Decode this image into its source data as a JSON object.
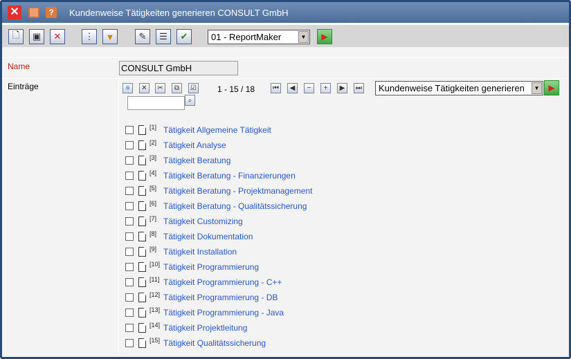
{
  "window": {
    "title": "Kundenweise Tätigkeiten generieren CONSULT GmbH"
  },
  "toolbar": {
    "report_select": "01 - ReportMaker"
  },
  "form": {
    "name_label": "Name",
    "name_value": "CONSULT GmbH",
    "entries_label": "Einträge"
  },
  "entries": {
    "pager": "1 - 15 / 18",
    "action_select": "Kundenweise Tätigkeiten generieren",
    "search_value": "",
    "items": [
      {
        "num": "[1]",
        "label": "Tätigkeit Allgemeine Tätigkeit"
      },
      {
        "num": "[2]",
        "label": "Tätigkeit Analyse"
      },
      {
        "num": "[3]",
        "label": "Tätigkeit Beratung"
      },
      {
        "num": "[4]",
        "label": "Tätigkeit Beratung - Finanzierungen"
      },
      {
        "num": "[5]",
        "label": "Tätigkeit Beratung - Projektmanagement"
      },
      {
        "num": "[6]",
        "label": "Tätigkeit Beratung - Qualitätssicherung"
      },
      {
        "num": "[7]",
        "label": "Tätigkeit Customizing"
      },
      {
        "num": "[8]",
        "label": "Tätigkeit Dokumentation"
      },
      {
        "num": "[9]",
        "label": "Tätigkeit Installation"
      },
      {
        "num": "[10]",
        "label": "Tätigkeit Programmierung"
      },
      {
        "num": "[11]",
        "label": "Tätigkeit Programmierung - C++"
      },
      {
        "num": "[12]",
        "label": "Tätigkeit Programmierung - DB"
      },
      {
        "num": "[13]",
        "label": "Tätigkeit Programmierung - Java"
      },
      {
        "num": "[14]",
        "label": "Tätigkeit Projektleitung"
      },
      {
        "num": "[15]",
        "label": "Tätigkeit Qualitätssicherung"
      }
    ]
  }
}
